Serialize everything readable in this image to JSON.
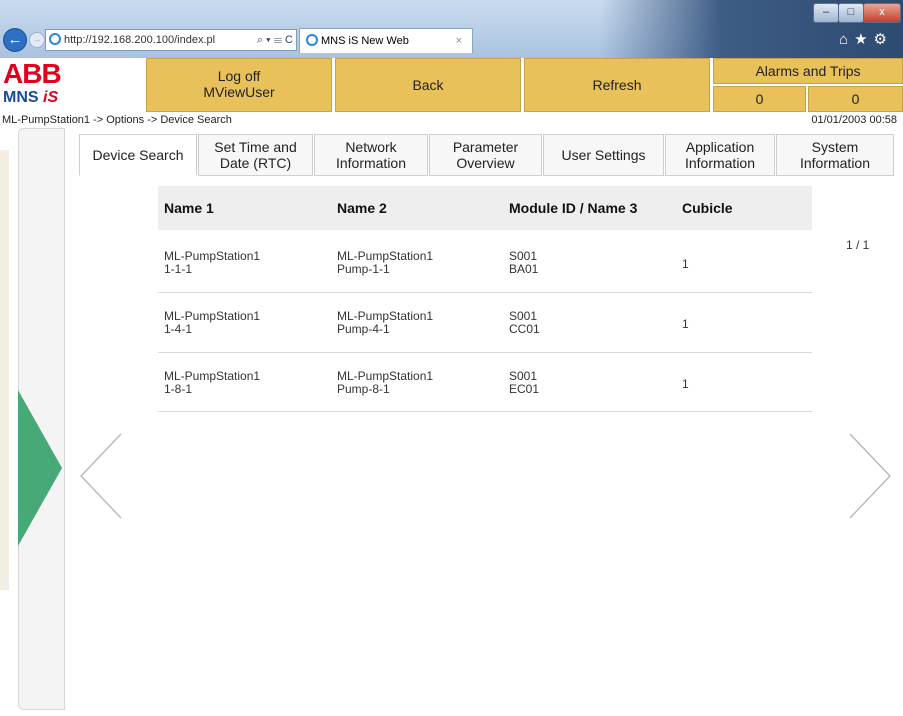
{
  "browser": {
    "url": "http://192.168.200.100/index.pl",
    "address_controls": "⌕ ▾ ☰ C",
    "tab_title": "MNS iS New Web",
    "tab_close": "×",
    "window_buttons": [
      "–",
      "□",
      "x"
    ],
    "toolbar_icons": "⌂★⚙"
  },
  "logo": {
    "brand": "ABB",
    "product_prefix": "MNS",
    "product_suffix": "iS"
  },
  "header": {
    "logoff_label": "Log off",
    "user": "MViewUser",
    "back_label": "Back",
    "refresh_label": "Refresh",
    "alarms_label": "Alarms and Trips",
    "alarm_count": "0",
    "trip_count": "0"
  },
  "breadcrumb": "ML-PumpStation1 -> Options -> Device Search",
  "datetime": "01/01/2003 00:58",
  "tabs": [
    {
      "label": "Device Search"
    },
    {
      "label": "Set Time and Date (RTC)"
    },
    {
      "label": "Network Information"
    },
    {
      "label": "Parameter Overview"
    },
    {
      "label": "User Settings"
    },
    {
      "label": "Application Information"
    },
    {
      "label": "System Information"
    }
  ],
  "table": {
    "headers": [
      "Name 1",
      "Name 2",
      "Module ID / Name 3",
      "Cubicle"
    ],
    "rows": [
      {
        "name1_a": "ML-PumpStation1",
        "name1_b": "1-1-1",
        "name2_a": "ML-PumpStation1",
        "name2_b": "Pump-1-1",
        "mod_a": "S001",
        "mod_b": "BA01",
        "cubicle": "1"
      },
      {
        "name1_a": "ML-PumpStation1",
        "name1_b": "1-4-1",
        "name2_a": "ML-PumpStation1",
        "name2_b": "Pump-4-1",
        "mod_a": "S001",
        "mod_b": "CC01",
        "cubicle": "1"
      },
      {
        "name1_a": "ML-PumpStation1",
        "name1_b": "1-8-1",
        "name2_a": "ML-PumpStation1",
        "name2_b": "Pump-8-1",
        "mod_a": "S001",
        "mod_b": "EC01",
        "cubicle": "1"
      }
    ]
  },
  "pagination": "1 / 1",
  "colors": {
    "header_button": "#e8c15a",
    "brand_red": "#e2001a",
    "brand_blue": "#1d4a96",
    "green_arrow": "#48a978"
  }
}
